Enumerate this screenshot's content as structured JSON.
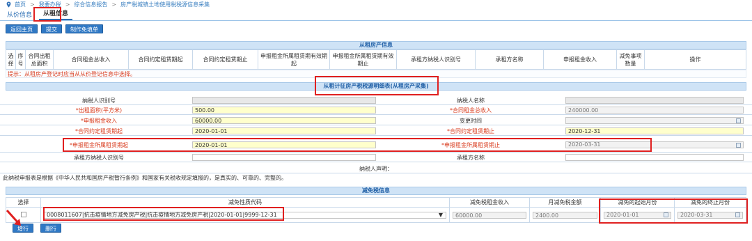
{
  "breadcrumb": {
    "items": [
      "首页",
      "我要办税",
      "综合信息报告",
      "房产税城镇土地使用税税源信息采集"
    ]
  },
  "tabs": [
    {
      "label": "从价信息"
    },
    {
      "label": "从租信息"
    }
  ],
  "toolbar": {
    "back": "返回主页",
    "submit": "提交",
    "voucher": "制作免填单"
  },
  "rent_info": {
    "title": "从租房产信息",
    "columns": [
      "选择",
      "序号",
      "合同出租总面积",
      "合同租金总收入",
      "合同约定租赁期起",
      "合同约定租赁期止",
      "申报租金所属租赁期有效期起",
      "申报租金所属租赁期有效期止",
      "承租方纳税人识别号",
      "承租方名称",
      "申报租金收入",
      "减免事项数量",
      "操作"
    ]
  },
  "hint": "提示：从租房产登记时应当从从价登记信息中选择。",
  "detail": {
    "title": "从租计征房产税税源明细表(从租房产采集)",
    "taxpayer_id_label": "纳税人识别号",
    "taxpayer_name_label": "纳税人名称",
    "area_label": "*出租面积(平方米)",
    "area_value": "500.00",
    "contract_income_label": "*合同租金总收入",
    "contract_income_value": "240000.00",
    "declared_income_label": "*申报租金收入",
    "declared_income_value": "60000.00",
    "change_time_label": "变更时间",
    "contract_start_label": "*合同约定租赁期起",
    "contract_start_value": "2020-01-01",
    "contract_end_label": "*合同约定租赁期止",
    "contract_end_value": "2020-12-31",
    "period_start_label": "*申报租金所属租赁期起",
    "period_start_value": "2020-01-01",
    "period_end_label": "*申报租金所属租赁期止",
    "period_end_value": "2020-03-31",
    "lessee_id_label": "承租方纳税人识别号",
    "lessee_name_label": "承租方名称",
    "declaration_label": "纳税人声明：",
    "declaration_text": "此纳税申报表是根据《中华人民共和国房产税暂行条例》和国家有关税收规定填报的，是真实的、可靠的、完整的。"
  },
  "relief": {
    "title": "减免税信息",
    "columns": [
      "选择",
      "减免性质代码",
      "减免税租金收入",
      "月减免税金额",
      "减免的起始月份",
      "减免的终止月份"
    ],
    "row": {
      "code": "0008011607|抗击疫情地方减免房产税|抗击疫情地方减免房产税|2020-01-01|9999-12-31",
      "income": "60000.00",
      "monthly_amount": "2400.00",
      "start_month": "2020-01-01",
      "end_month": "2020-03-31"
    },
    "add_button": "增行",
    "delete_button": "删行"
  },
  "colors": {
    "accent": "#2f78c4",
    "highlight": "#e02020",
    "required": "#d83a1c",
    "section": "#cfe3f6"
  }
}
